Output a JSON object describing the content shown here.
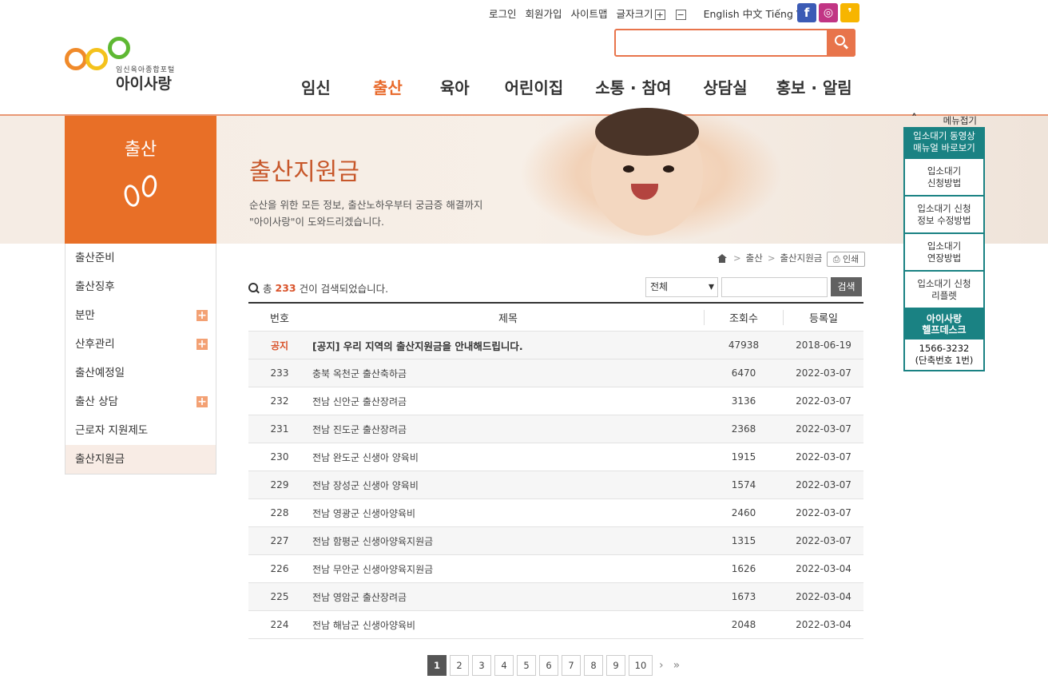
{
  "util": {
    "login": "로그인",
    "join": "회원가입",
    "sitemap": "사이트맵",
    "fontsize": "글자크기",
    "plus": "+",
    "minus": "−",
    "lang": "English 中文 Tiếng Việt"
  },
  "sns": {
    "facebook": "f",
    "instagram": "◎",
    "kakao": "❜"
  },
  "logo": {
    "sub": "임신육아종합포털",
    "main": "아이사랑"
  },
  "gnb": [
    "임신",
    "출산",
    "육아",
    "어린이집",
    "소통 · 참여",
    "상담실",
    "홍보 · 알림"
  ],
  "side": {
    "title": "출산",
    "items": [
      {
        "label": "출산준비",
        "plus": ""
      },
      {
        "label": "출산징후",
        "plus": ""
      },
      {
        "label": "분만",
        "plus": "+"
      },
      {
        "label": "산후관리",
        "plus": "+"
      },
      {
        "label": "출산예정일",
        "plus": ""
      },
      {
        "label": "출산 상담",
        "plus": "+"
      },
      {
        "label": "근로자 지원제도",
        "plus": ""
      },
      {
        "label": "출산지원금",
        "plus": ""
      }
    ]
  },
  "banner": {
    "title": "출산지원금",
    "desc1": "순산을 위한 모든 정보, 출산노하우부터 궁금증 해결까지",
    "desc2": "\"아이사랑\"이 도와드리겠습니다."
  },
  "location": {
    "sep": ">",
    "level1": "출산",
    "level2": "출산지원금",
    "print": "인쇄"
  },
  "count": {
    "prefix": "총",
    "num": "233",
    "suffix": "건이 검색되었습니다."
  },
  "search": {
    "select": "전체",
    "button": "검색"
  },
  "table": {
    "headers": [
      "번호",
      "제목",
      "조회수",
      "등록일"
    ],
    "rows": [
      {
        "no": "공지",
        "title": "[공지] 우리 지역의 출산지원금을 안내해드립니다.",
        "views": "47938",
        "date": "2018-06-19"
      },
      {
        "no": "233",
        "title": "충북 옥천군 출산축하금",
        "views": "6470",
        "date": "2022-03-07"
      },
      {
        "no": "232",
        "title": "전남 신안군 출산장려금",
        "views": "3136",
        "date": "2022-03-07"
      },
      {
        "no": "231",
        "title": "전남 진도군 출산장려금",
        "views": "2368",
        "date": "2022-03-07"
      },
      {
        "no": "230",
        "title": "전남 완도군 신생아 양육비",
        "views": "1915",
        "date": "2022-03-07"
      },
      {
        "no": "229",
        "title": "전남 장성군 신생아 양육비",
        "views": "1574",
        "date": "2022-03-07"
      },
      {
        "no": "228",
        "title": "전남 영광군 신생아양육비",
        "views": "2460",
        "date": "2022-03-07"
      },
      {
        "no": "227",
        "title": "전남 함평군 신생아양육지원금",
        "views": "1315",
        "date": "2022-03-07"
      },
      {
        "no": "226",
        "title": "전남 무안군 신생아양육지원금",
        "views": "1626",
        "date": "2022-03-04"
      },
      {
        "no": "225",
        "title": "전남 영암군 출산장려금",
        "views": "1673",
        "date": "2022-03-04"
      },
      {
        "no": "224",
        "title": "전남 해남군 신생아양육비",
        "views": "2048",
        "date": "2022-03-04"
      }
    ]
  },
  "paging": {
    "pages": [
      "1",
      "2",
      "3",
      "4",
      "5",
      "6",
      "7",
      "8",
      "9",
      "10"
    ],
    "next": "›",
    "last": "»"
  },
  "quick": {
    "fold": "메뉴접기",
    "top1": "입소대기 동영상",
    "top2": "매뉴얼 바로보기",
    "items": [
      {
        "l1": "입소대기",
        "l2": "신청방법"
      },
      {
        "l1": "입소대기 신청",
        "l2": "정보 수정방법"
      },
      {
        "l1": "입소대기",
        "l2": "연장방법"
      },
      {
        "l1": "입소대기 신청",
        "l2": "리플렛"
      }
    ],
    "help1": "아이사랑",
    "help2": "헬프데스크",
    "tel1": "1566-3232",
    "tel2": "(단축번호 1번)"
  }
}
